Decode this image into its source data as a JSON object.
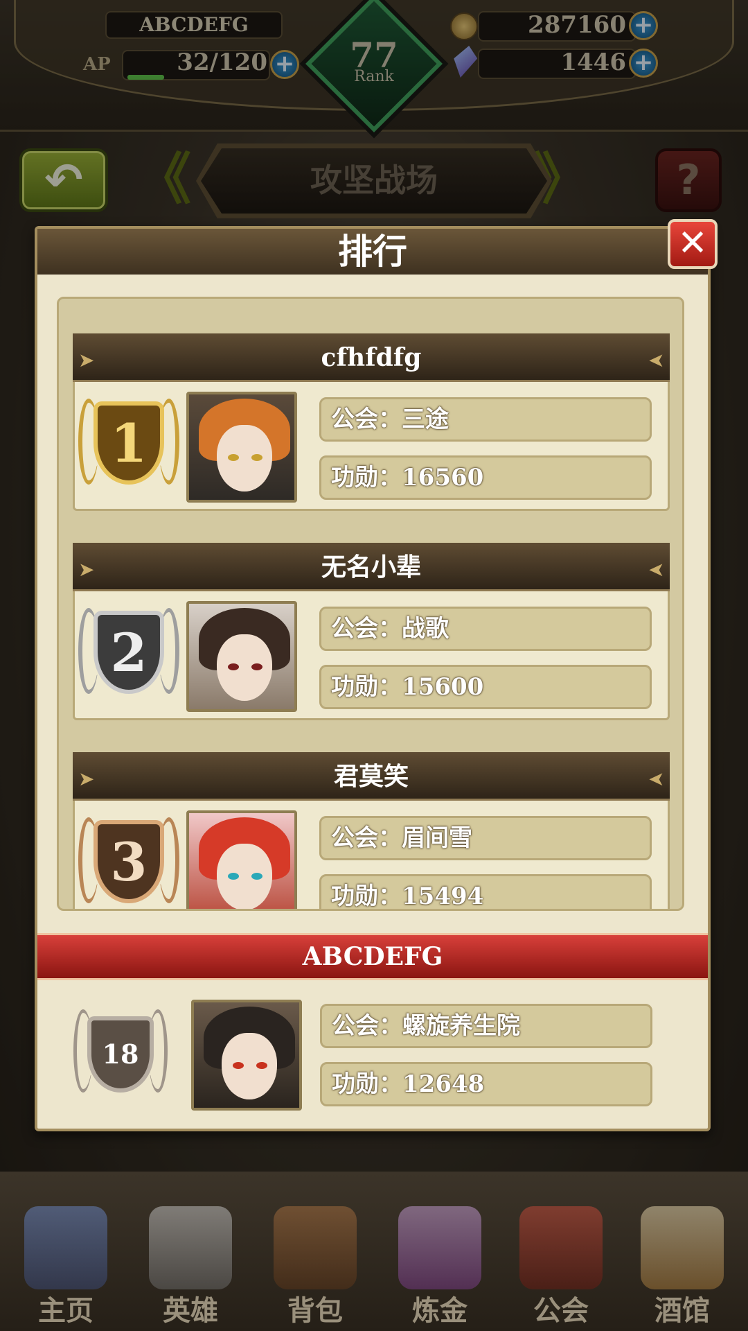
{
  "hud": {
    "player_name": "ABCDEFG",
    "ap_label": "AP",
    "ap": "32/120",
    "ap_fraction": 0.2667,
    "rank_value": "77",
    "rank_label": "Rank",
    "gold": "287160",
    "gems": "1446",
    "plus": "+"
  },
  "header": {
    "back_icon": "undo-arrow-icon",
    "back_glyph": "↶",
    "title": "攻坚战场",
    "help_glyph": "?"
  },
  "dialog": {
    "title": "排行",
    "close_glyph": "✕"
  },
  "ranking": [
    {
      "rank": "1",
      "name": "cfhfdfg",
      "guild": "公会：三途",
      "merit": "功勋：16560",
      "medal_color": "gold"
    },
    {
      "rank": "2",
      "name": "无名小辈",
      "guild": "公会：战歌",
      "merit": "功勋：15600",
      "medal_color": "silver"
    },
    {
      "rank": "3",
      "name": "君莫笑",
      "guild": "公会：眉间雪",
      "merit": "功勋：15494",
      "medal_color": "bronze"
    }
  ],
  "self": {
    "name": "ABCDEFG",
    "rank": "18",
    "guild": "公会：螺旋养生院",
    "merit": "功勋：12648"
  },
  "nav": [
    {
      "label": "主页",
      "icon": "castle-icon"
    },
    {
      "label": "英雄",
      "icon": "hero-helmet-icon"
    },
    {
      "label": "背包",
      "icon": "backpack-icon"
    },
    {
      "label": "炼金",
      "icon": "alchemy-flask-icon"
    },
    {
      "label": "公会",
      "icon": "guild-shield-icon"
    },
    {
      "label": "酒馆",
      "icon": "tavern-beer-icon"
    }
  ]
}
